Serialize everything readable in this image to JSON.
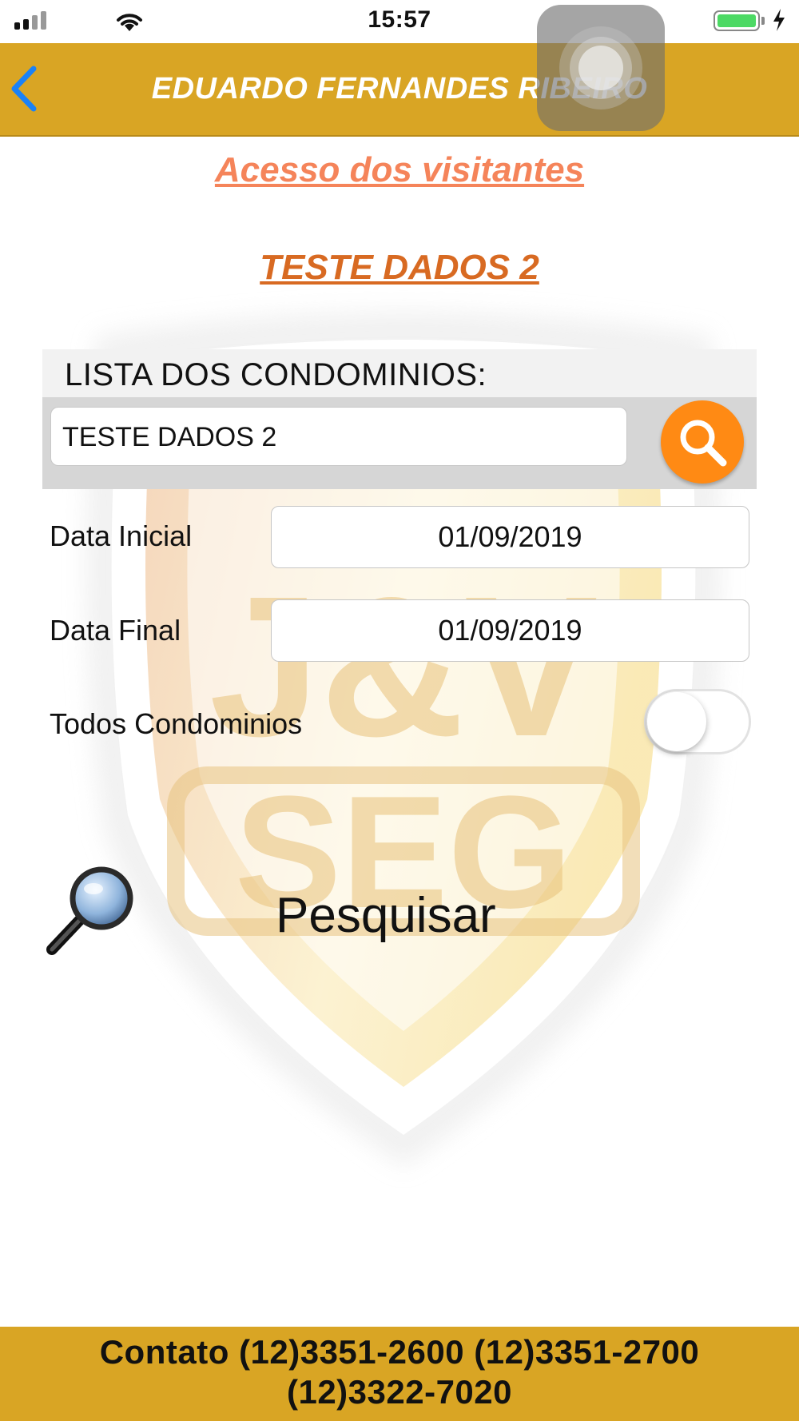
{
  "status_bar": {
    "time": "15:57",
    "battery_color": "#4cd964"
  },
  "nav": {
    "title": "EDUARDO FERNANDES RIBEIRO",
    "back_icon": "chevron-left-icon",
    "bar_color": "#d9a524"
  },
  "page": {
    "heading": "Acesso dos visitantes",
    "selected_condo": "TESTE DADOS 2"
  },
  "condo_list": {
    "label": "LISTA DOS CONDOMINIOS:",
    "value": "TESTE DADOS 2",
    "search_icon": "search-icon",
    "search_color": "#ff8a14"
  },
  "form": {
    "start_label": "Data Inicial",
    "start_value": "01/09/2019",
    "end_label": "Data Final",
    "end_value": "01/09/2019",
    "all_condos_label": "Todos Condominios",
    "all_condos_on": false
  },
  "action": {
    "search_label": "Pesquisar",
    "icon": "magnifying-glass-icon"
  },
  "background_logo": {
    "text": "J&V SEG"
  },
  "footer": {
    "line1": "Contato (12)3351-2600 (12)3351-2700",
    "line2": "(12)3322-7020",
    "color": "#d9a524"
  }
}
